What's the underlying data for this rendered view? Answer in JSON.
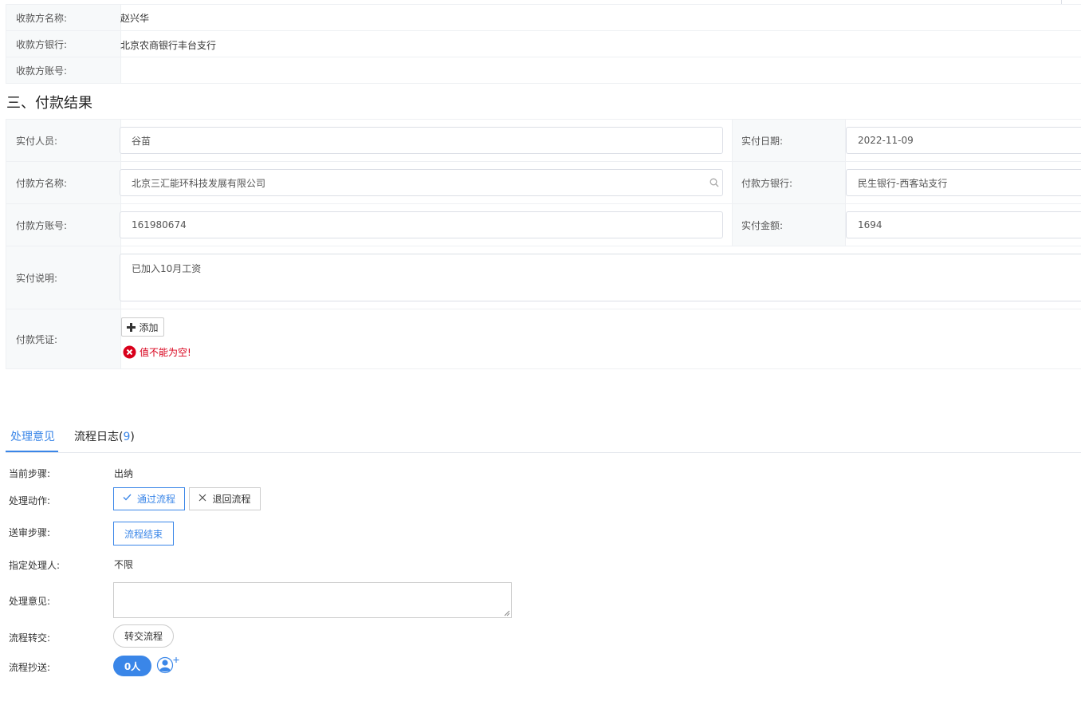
{
  "payee": {
    "name_label": "收款方名称:",
    "name_value": "赵兴华",
    "bank_label": "收款方银行:",
    "bank_value": "北京农商银行丰台支行",
    "account_label": "收款方账号:",
    "account_value": ""
  },
  "section3": {
    "title": "三、付款结果"
  },
  "payment": {
    "payer_person_label": "实付人员:",
    "payer_person_value": "谷苗",
    "pay_date_label": "实付日期:",
    "pay_date_value": "2022-11-09",
    "payer_name_label": "付款方名称:",
    "payer_name_value": "北京三汇能环科技发展有限公司",
    "payer_bank_label": "付款方银行:",
    "payer_bank_value": "民生银行-西客站支行",
    "payer_account_label": "付款方账号:",
    "payer_account_value": "161980674",
    "amount_label": "实付金额:",
    "amount_value": "1694",
    "note_label": "实付说明:",
    "note_value": "已加入10月工资",
    "voucher_label": "付款凭证:",
    "add_label": "添加",
    "error_text": "值不能为空!"
  },
  "tabs": {
    "opinion": "处理意见",
    "log": "流程日志(",
    "log_count": "9",
    "log_close": ")"
  },
  "flow": {
    "current_step_label": "当前步骤:",
    "current_step_value": "出纳",
    "action_label": "处理动作:",
    "approve_label": "通过流程",
    "reject_label": "退回流程",
    "send_step_label": "送审步骤:",
    "end_label": "流程结束",
    "assignee_label": "指定处理人:",
    "assignee_value": "不限",
    "opinion_label": "处理意见:",
    "opinion_value": "",
    "transfer_label": "流程转交:",
    "transfer_button": "转交流程",
    "cc_label": "流程抄送:",
    "cc_count": "0人"
  },
  "colors": {
    "accent": "#3a86e8",
    "error": "#d9001b",
    "label_bg": "#f7f9fa",
    "border": "#eef0f3"
  }
}
